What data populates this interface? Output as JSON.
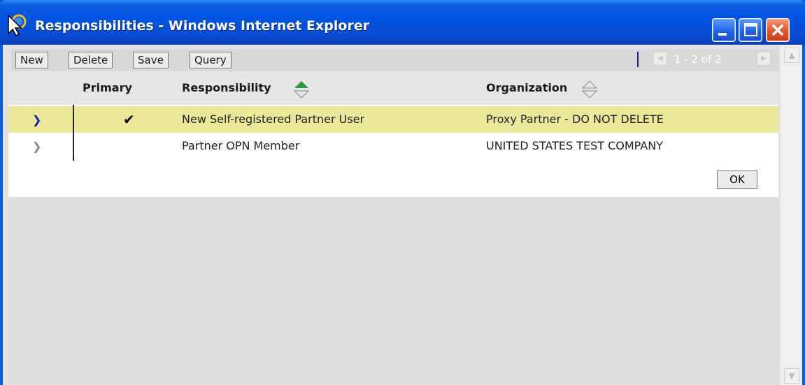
{
  "window": {
    "title": "Responsibilities - Windows Internet Explorer"
  },
  "toolbar": {
    "new_label": "New",
    "delete_label": "Delete",
    "save_label": "Save",
    "query_label": "Query",
    "pager_text": "1 - 2 of 2"
  },
  "table": {
    "headers": {
      "primary": "Primary",
      "responsibility": "Responsibility",
      "organization": "Organization"
    },
    "rows": [
      {
        "primary": true,
        "responsibility": "New Self-registered Partner User",
        "organization": "Proxy Partner - DO NOT DELETE",
        "selected": true
      },
      {
        "primary": false,
        "responsibility": "Partner OPN Member",
        "organization": "UNITED STATES TEST COMPANY",
        "selected": false
      }
    ]
  },
  "footer": {
    "ok_label": "OK"
  },
  "colors": {
    "selected_row": "#ebe89a",
    "sort_active": "#2e9a3a",
    "titlebar": "#0054e3"
  }
}
